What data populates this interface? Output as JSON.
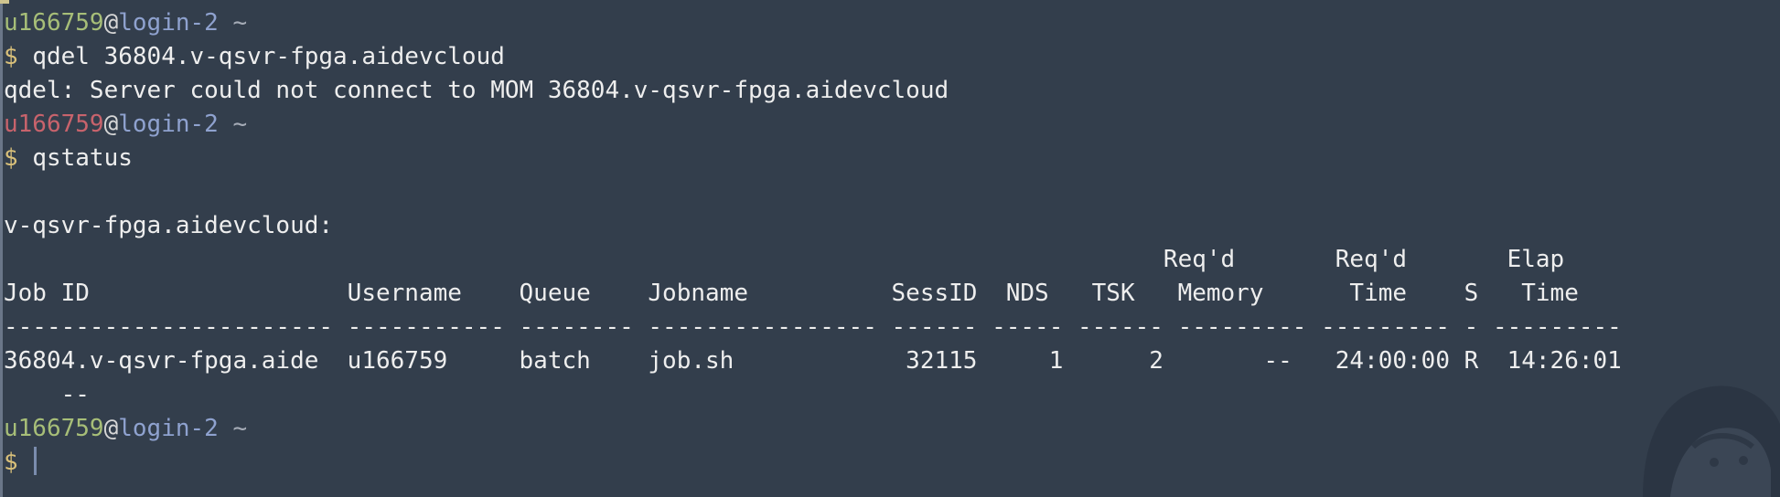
{
  "colors": {
    "background": "#333e4c",
    "user_green": "#a7be78",
    "user_red": "#c8636c",
    "host": "#8fa2cf",
    "prompt_symbol": "#d9c07a",
    "text": "#eeeeee"
  },
  "icons": {
    "cursor": "text-cursor-icon",
    "decoration": "background-art-icon"
  },
  "prompt": {
    "user": "u166759",
    "at": "@",
    "host": "login-2",
    "dir": "~",
    "symbol": "$"
  },
  "lines": {
    "cmd1": "qdel 36804.v-qsvr-fpga.aidevcloud",
    "out1": "qdel: Server could not connect to MOM 36804.v-qsvr-fpga.aidevcloud",
    "cmd2": "qstatus",
    "server": "v-qsvr-fpga.aidevcloud:",
    "header1": "                                                                                 Req'd       Req'd       Elap",
    "header2": "Job ID                  Username    Queue    Jobname          SessID  NDS   TSK   Memory      Time    S   Time",
    "separator": "----------------------- ----------- -------- ---------------- ------ ----- ------ --------- --------- - ---------",
    "row": "36804.v-qsvr-fpga.aide  u166759     batch    job.sh            32115     1      2       --   24:00:00 R  14:26:01",
    "row_wrap": "    --"
  }
}
